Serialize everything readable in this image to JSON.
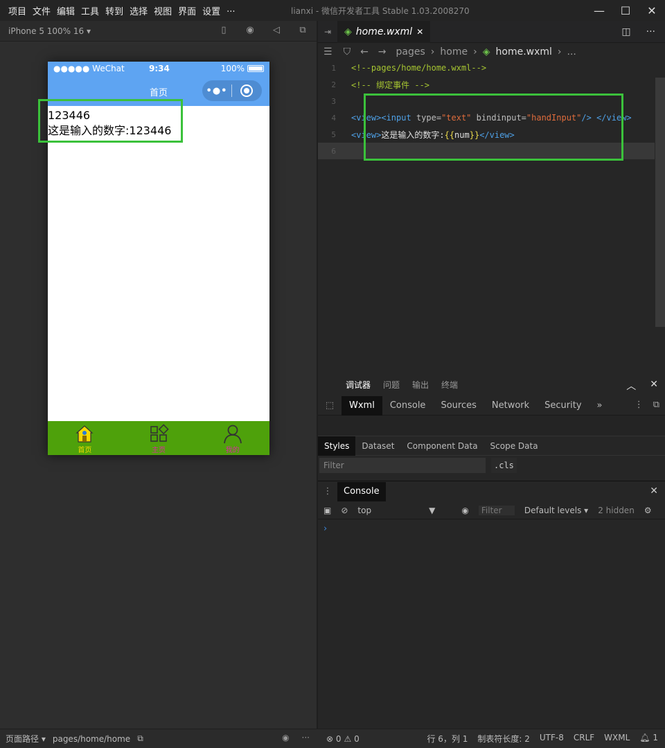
{
  "menu": [
    "项目",
    "文件",
    "编辑",
    "工具",
    "转到",
    "选择",
    "视图",
    "界面",
    "设置",
    "..."
  ],
  "window_title": "lianxi - 微信开发者工具 Stable 1.03.2008270",
  "simulator": {
    "device_label": "iPhone 5 100% 16 ▾",
    "status": {
      "carrier": "●●●●● WeChat",
      "time": "9:34",
      "battery": "100%"
    },
    "nav_title": "首页",
    "content_lines": [
      "123446",
      "这是输入的数字:123446"
    ],
    "tabs": [
      {
        "label": "首页",
        "icon": "home-icon",
        "color": "#f5d800"
      },
      {
        "label": "主页",
        "icon": "grid-icon",
        "color": "#d92aa0"
      },
      {
        "label": "我的",
        "icon": "person-icon",
        "color": "#d92aa0"
      }
    ]
  },
  "editor": {
    "tab_label": "home.wxml",
    "breadcrumb": [
      "pages",
      "home",
      "home.wxml",
      "..."
    ],
    "lines": [
      {
        "num": "1",
        "text": "<!--pages/home/home.wxml-->"
      },
      {
        "num": "2",
        "text": "<!-- 绑定事件 -->"
      },
      {
        "num": "3",
        "text": ""
      },
      {
        "num": "4",
        "parts": [
          "<view>",
          "<input ",
          "type=",
          "\"text\"",
          " bindinput=",
          "\"handInput\"",
          "/> ",
          "</view>"
        ]
      },
      {
        "num": "5",
        "parts": [
          "<view>",
          "这是输入的数字:",
          "{{",
          "num",
          "}}",
          "</view>"
        ]
      },
      {
        "num": "6",
        "text": ""
      }
    ]
  },
  "debugger": {
    "top_tabs": [
      "调试器",
      "问题",
      "输出",
      "终端"
    ],
    "devtools_tabs": [
      "Wxml",
      "Console",
      "Sources",
      "Network",
      "Security",
      "»"
    ],
    "styles_tabs": [
      "Styles",
      "Dataset",
      "Component Data",
      "Scope Data"
    ],
    "filter_placeholder": "Filter",
    "cls_label": ".cls",
    "console_label": "Console",
    "console_toolbar": {
      "context": "top",
      "filter": "Filter",
      "levels": "Default levels ▾",
      "hidden": "2 hidden"
    },
    "prompt": "›"
  },
  "bottombar": {
    "page_path_label": "页面路径 ▾",
    "page_path": "pages/home/home",
    "errors": "⊗ 0",
    "warnings": "⚠ 0",
    "cursor": "行 6，列 1",
    "tab_size": "制表符长度: 2",
    "encoding": "UTF-8",
    "eol": "CRLF",
    "language": "WXML",
    "notifications": "1"
  },
  "colors": {
    "highlight": "#3bc13b",
    "navbar": "#5ea4f2",
    "tabbar": "#4ea10b"
  }
}
